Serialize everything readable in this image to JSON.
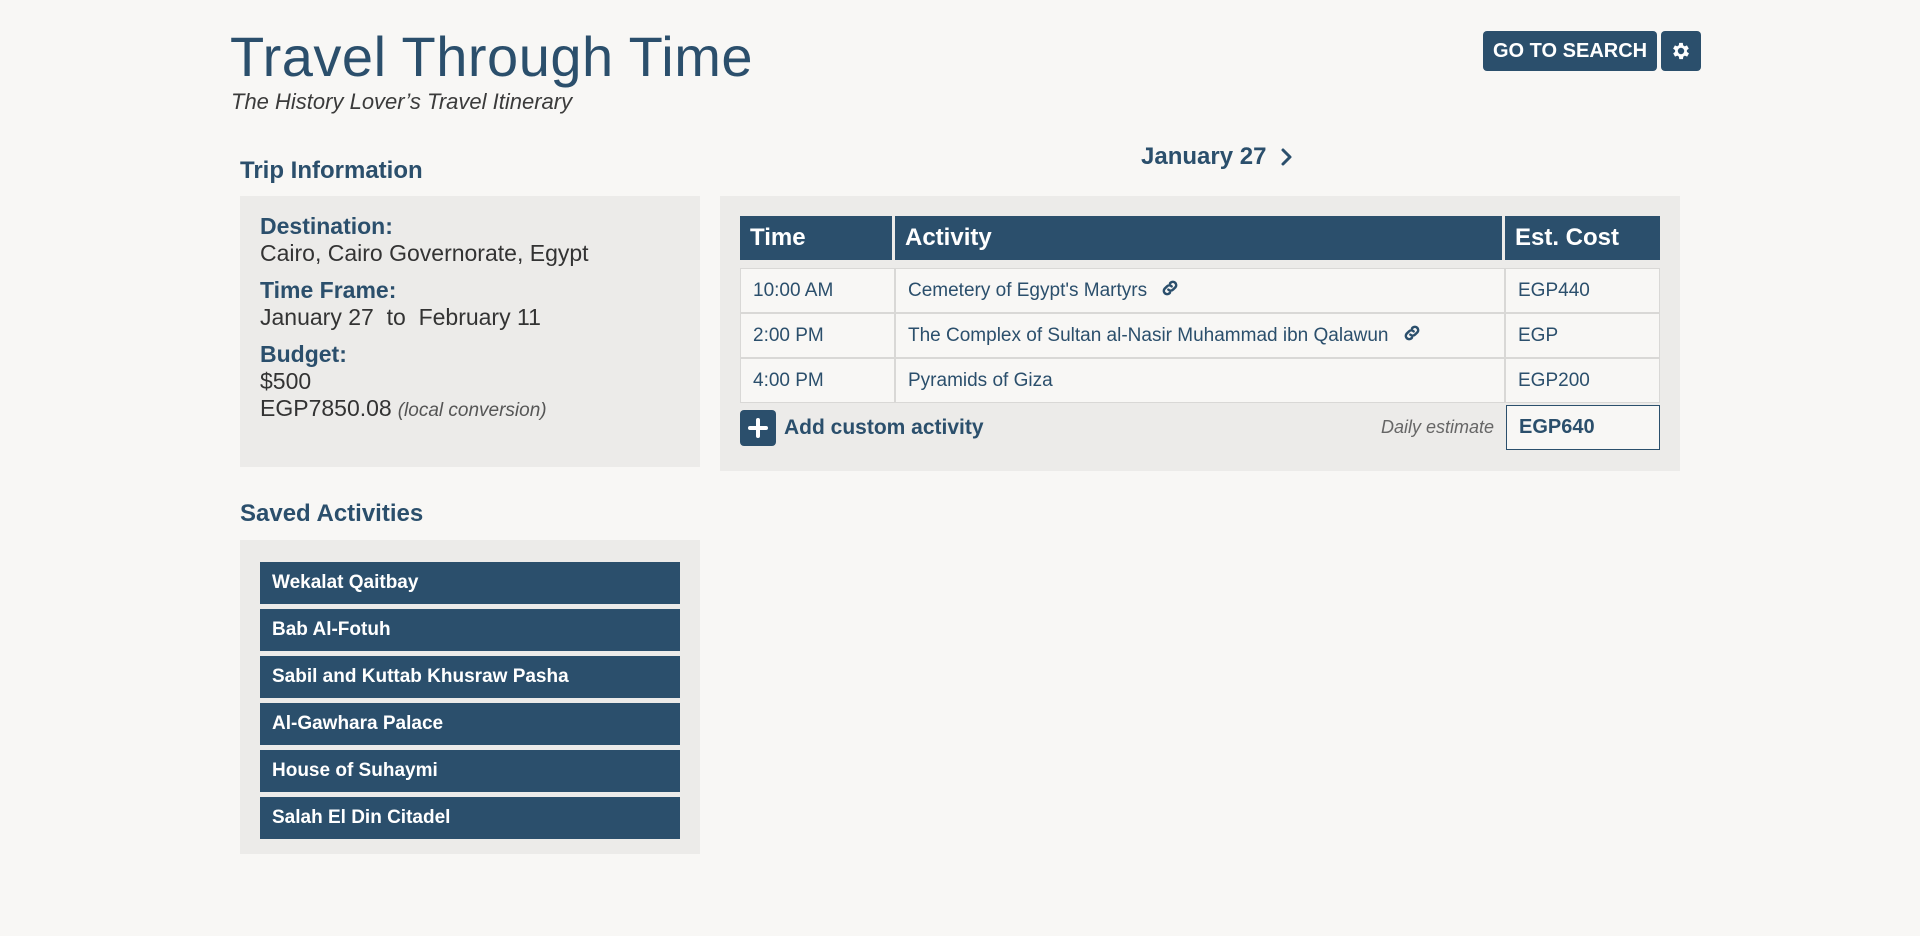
{
  "header": {
    "title": "Travel Through Time",
    "subtitle": "The History Lover’s Travel Itinerary",
    "search_button": "GO TO SEARCH",
    "settings_icon": "gear-icon"
  },
  "trip_info": {
    "heading": "Trip Information",
    "destination_label": "Destination:",
    "destination": "Cairo, Cairo Governorate, Egypt",
    "timeframe_label": "Time Frame:",
    "start_date": "January 27",
    "to_word": "to",
    "end_date": "February 11",
    "budget_label": "Budget:",
    "budget_usd": "$500",
    "budget_local": "EGP7850.08",
    "conversion_note": "(local conversion)"
  },
  "saved": {
    "heading": "Saved Activities",
    "items": [
      "Wekalat Qaitbay",
      "Bab Al-Fotuh",
      "Sabil and Kuttab Khusraw Pasha",
      "Al-Gawhara Palace",
      "House of Suhaymi",
      "Salah El Din Citadel"
    ]
  },
  "schedule": {
    "date": "January 27",
    "columns": [
      "Time",
      "Activity",
      "Est. Cost"
    ],
    "rows": [
      {
        "time": "10:00 AM",
        "activity": "Cemetery of Egypt's Martyrs",
        "cost": "EGP440",
        "has_link": true
      },
      {
        "time": "2:00 PM",
        "activity": "The Complex of Sultan al-Nasir Muhammad ibn Qalawun",
        "cost": "EGP",
        "has_link": true
      },
      {
        "time": "4:00 PM",
        "activity": "Pyramids of Giza",
        "cost": "EGP200",
        "has_link": false
      }
    ],
    "add_label": "Add custom activity",
    "estimate_label": "Daily estimate",
    "estimate_value": "EGP640"
  },
  "colors": {
    "primary": "#2b4f6c",
    "background": "#f8f7f5",
    "panel": "#ecebe9"
  }
}
